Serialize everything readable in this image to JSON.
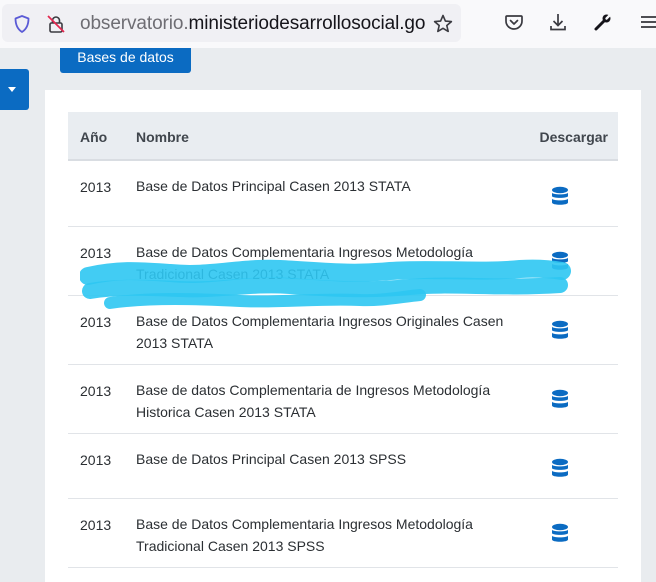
{
  "browser": {
    "url_host": "observatorio.",
    "url_domain": "ministeriodesarrollosocial.gob.cl",
    "icons": [
      "shield-icon",
      "lock-off-icon",
      "bookmark-star-icon",
      "pocket-icon",
      "download-icon",
      "wrench-icon",
      "hamburger-menu-icon"
    ]
  },
  "page": {
    "bases_button": "Bases de datos",
    "accent_color": "#0b6bc2"
  },
  "table": {
    "headers": {
      "year": "Año",
      "name": "Nombre",
      "download": "Descargar"
    },
    "rows": [
      {
        "year": "2013",
        "name": "Base de Datos Principal Casen 2013 STATA"
      },
      {
        "year": "2013",
        "name": "Base de Datos Complementaria Ingresos Metodología Tradicional Casen 2013 STATA"
      },
      {
        "year": "2013",
        "name": "Base de Datos Complementaria Ingresos Originales Casen 2013 STATA"
      },
      {
        "year": "2013",
        "name": "Base de datos Complementaria de Ingresos Metodología Historica Casen 2013 STATA"
      },
      {
        "year": "2013",
        "name": "Base de Datos Principal Casen 2013 SPSS"
      },
      {
        "year": "2013",
        "name": "Base de Datos Complementaria Ingresos Metodología Tradicional Casen 2013 SPSS"
      }
    ]
  }
}
